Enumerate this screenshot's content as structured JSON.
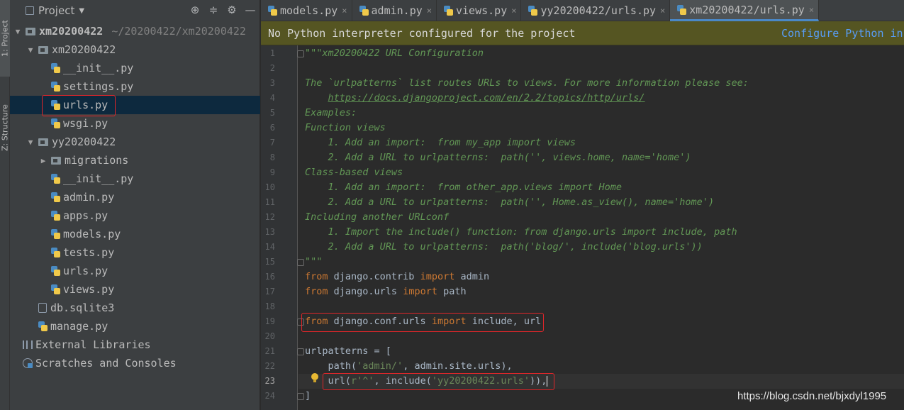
{
  "tool_strip": {
    "project_tab": "1: Project",
    "structure_tab": "Z: Structure"
  },
  "project_panel": {
    "title": "Project",
    "dropdown_icon": "chevron-down-icon",
    "tools": [
      "target-icon",
      "collapse-icon",
      "gear-icon",
      "minimize-icon"
    ],
    "tree": [
      {
        "label": "xm20200422",
        "hint": "~/20200422/xm20200422",
        "icon": "folder-icon",
        "expanded": true
      },
      {
        "label": "xm20200422",
        "icon": "folder-icon",
        "expanded": true
      },
      {
        "label": "__init__.py",
        "icon": "python-file-icon"
      },
      {
        "label": "settings.py",
        "icon": "python-file-icon"
      },
      {
        "label": "urls.py",
        "icon": "python-file-icon",
        "selected": true
      },
      {
        "label": "wsgi.py",
        "icon": "python-file-icon"
      },
      {
        "label": "yy20200422",
        "icon": "folder-icon",
        "expanded": true
      },
      {
        "label": "migrations",
        "icon": "folder-icon",
        "expanded": false
      },
      {
        "label": "__init__.py",
        "icon": "python-file-icon"
      },
      {
        "label": "admin.py",
        "icon": "python-file-icon"
      },
      {
        "label": "apps.py",
        "icon": "python-file-icon"
      },
      {
        "label": "models.py",
        "icon": "python-file-icon"
      },
      {
        "label": "tests.py",
        "icon": "python-file-icon"
      },
      {
        "label": "urls.py",
        "icon": "python-file-icon"
      },
      {
        "label": "views.py",
        "icon": "python-file-icon"
      },
      {
        "label": "db.sqlite3",
        "icon": "database-icon"
      },
      {
        "label": "manage.py",
        "icon": "python-file-icon"
      },
      {
        "label": "External Libraries",
        "icon": "library-icon"
      },
      {
        "label": "Scratches and Consoles",
        "icon": "scratches-icon"
      }
    ]
  },
  "tabs": [
    {
      "label": "models.py",
      "active": false
    },
    {
      "label": "admin.py",
      "active": false
    },
    {
      "label": "views.py",
      "active": false
    },
    {
      "label": "yy20200422/urls.py",
      "active": false
    },
    {
      "label": "xm20200422/urls.py",
      "active": true
    }
  ],
  "banner": {
    "message": "No Python interpreter configured for the project",
    "action": "Configure Python in"
  },
  "editor": {
    "current_line": 23,
    "lines": [
      {
        "n": "1",
        "parts": [
          [
            "doc",
            "\"\"\"xm20200422 URL Configuration"
          ]
        ]
      },
      {
        "n": "2",
        "parts": []
      },
      {
        "n": "3",
        "parts": [
          [
            "doc",
            "The `urlpatterns` list routes URLs to views. For more information please see:"
          ]
        ]
      },
      {
        "n": "4",
        "parts": [
          [
            "doc",
            "    "
          ],
          [
            "doc-link",
            "https://docs.djangoproject.com/en/2.2/topics/http/urls/"
          ]
        ]
      },
      {
        "n": "5",
        "parts": [
          [
            "doc",
            "Examples:"
          ]
        ]
      },
      {
        "n": "6",
        "parts": [
          [
            "doc",
            "Function views"
          ]
        ]
      },
      {
        "n": "7",
        "parts": [
          [
            "doc",
            "    1. Add an import:  from my_app import views"
          ]
        ]
      },
      {
        "n": "8",
        "parts": [
          [
            "doc",
            "    2. Add a URL to urlpatterns:  path('', views.home, name='home')"
          ]
        ]
      },
      {
        "n": "9",
        "parts": [
          [
            "doc",
            "Class-based views"
          ]
        ]
      },
      {
        "n": "10",
        "parts": [
          [
            "doc",
            "    1. Add an import:  from other_app.views import Home"
          ]
        ]
      },
      {
        "n": "11",
        "parts": [
          [
            "doc",
            "    2. Add a URL to urlpatterns:  path('', Home.as_view(), name='home')"
          ]
        ]
      },
      {
        "n": "12",
        "parts": [
          [
            "doc",
            "Including another URLconf"
          ]
        ]
      },
      {
        "n": "13",
        "parts": [
          [
            "doc",
            "    1. Import the include() function: from django.urls import include, path"
          ]
        ]
      },
      {
        "n": "14",
        "parts": [
          [
            "doc",
            "    2. Add a URL to urlpatterns:  path('blog/', include('blog.urls'))"
          ]
        ]
      },
      {
        "n": "15",
        "parts": [
          [
            "doc",
            "\"\"\""
          ]
        ]
      },
      {
        "n": "16",
        "parts": [
          [
            "kw",
            "from"
          ],
          [
            "pl",
            " django.contrib "
          ],
          [
            "kw",
            "import"
          ],
          [
            "pl",
            " admin"
          ]
        ]
      },
      {
        "n": "17",
        "parts": [
          [
            "kw",
            "from"
          ],
          [
            "pl",
            " django.urls "
          ],
          [
            "kw",
            "import"
          ],
          [
            "pl",
            " path"
          ]
        ]
      },
      {
        "n": "18",
        "parts": []
      },
      {
        "n": "19",
        "parts": [
          [
            "kw",
            "from"
          ],
          [
            "pl",
            " django.conf.urls "
          ],
          [
            "kw",
            "import"
          ],
          [
            "pl",
            " include, url"
          ]
        ]
      },
      {
        "n": "20",
        "parts": []
      },
      {
        "n": "21",
        "parts": [
          [
            "pl",
            "urlpatterns = ["
          ]
        ]
      },
      {
        "n": "22",
        "parts": [
          [
            "pl",
            "    path("
          ],
          [
            "str",
            "'admin/'"
          ],
          [
            "pl",
            ", admin.site.urls),"
          ]
        ]
      },
      {
        "n": "23",
        "parts": [
          [
            "pl",
            "    url("
          ],
          [
            "str",
            "r'^'"
          ],
          [
            "pl",
            ", include("
          ],
          [
            "str",
            "'yy20200422.urls'"
          ],
          [
            "pl",
            ")),"
          ]
        ]
      },
      {
        "n": "24",
        "parts": [
          [
            "pl",
            "]"
          ]
        ]
      }
    ]
  },
  "watermark": "https://blog.csdn.net/bjxdyl1995",
  "colors": {
    "panel_bg": "#3c3f41",
    "editor_bg": "#2b2b2b",
    "selection": "#0d293e",
    "banner_bg": "#555522",
    "link": "#589df6",
    "docstring": "#629755",
    "keyword": "#cc7832",
    "string": "#6a8759",
    "highlight_box": "#e0262a"
  }
}
